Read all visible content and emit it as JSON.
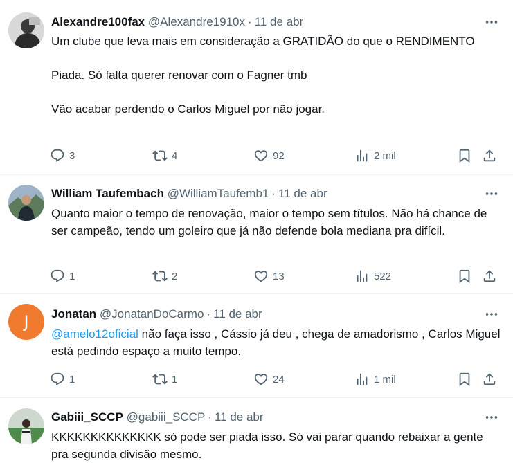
{
  "tweets": [
    {
      "name": "Alexandre100fax",
      "handle": "@Alexandre1910x",
      "date": "11 de abr",
      "avatar": "photo",
      "text": {
        "p1": "Um clube que leva mais em consideração a GRATIDÃO do que o RENDIMENTO",
        "p2": "Piada. Só falta querer renovar com o Fagner tmb",
        "p3": "Vão acabar perdendo o Carlos Miguel por não jogar."
      },
      "replies": "3",
      "retweets": "4",
      "likes": "92",
      "views": "2 mil"
    },
    {
      "name": "William Taufembach",
      "handle": "@WilliamTaufemb1",
      "date": "11 de abr",
      "avatar": "photo",
      "text": {
        "p1": "Quanto maior o tempo de renovação, maior o tempo sem títulos. Não há chance de ser campeão, tendo um goleiro que já não defende bola mediana pra difícil."
      },
      "replies": "1",
      "retweets": "2",
      "likes": "13",
      "views": "522"
    },
    {
      "name": "Jonatan",
      "handle": "@JonatanDoCarmo",
      "date": "11 de abr",
      "avatar": "J",
      "text": {
        "mention": "@amelo12oficial",
        "p1": " não faça isso , Cássio já deu , chega de amadorismo , Carlos Miguel está pedindo espaço a muito tempo."
      },
      "replies": "1",
      "retweets": "1",
      "likes": "24",
      "views": "1 mil"
    },
    {
      "name": "Gabiii_SCCP",
      "handle": "@gabiii_SCCP",
      "date": "11 de abr",
      "avatar": "photo",
      "text": {
        "p1": "KKKKKKKKKKKKKK só pode ser piada isso. Só vai parar quando rebaixar a gente pra segunda divisão mesmo."
      }
    }
  ],
  "icons": {
    "more": "more-icon",
    "reply": "reply-icon",
    "retweet": "retweet-icon",
    "like": "like-icon",
    "views": "views-icon",
    "bookmark": "bookmark-icon",
    "share": "share-icon"
  },
  "colors": {
    "text": "#0f1419",
    "secondary": "#536471",
    "mention": "#1d9bf0",
    "divider": "#eff3f4",
    "avatar_j": "#f07a2e"
  }
}
